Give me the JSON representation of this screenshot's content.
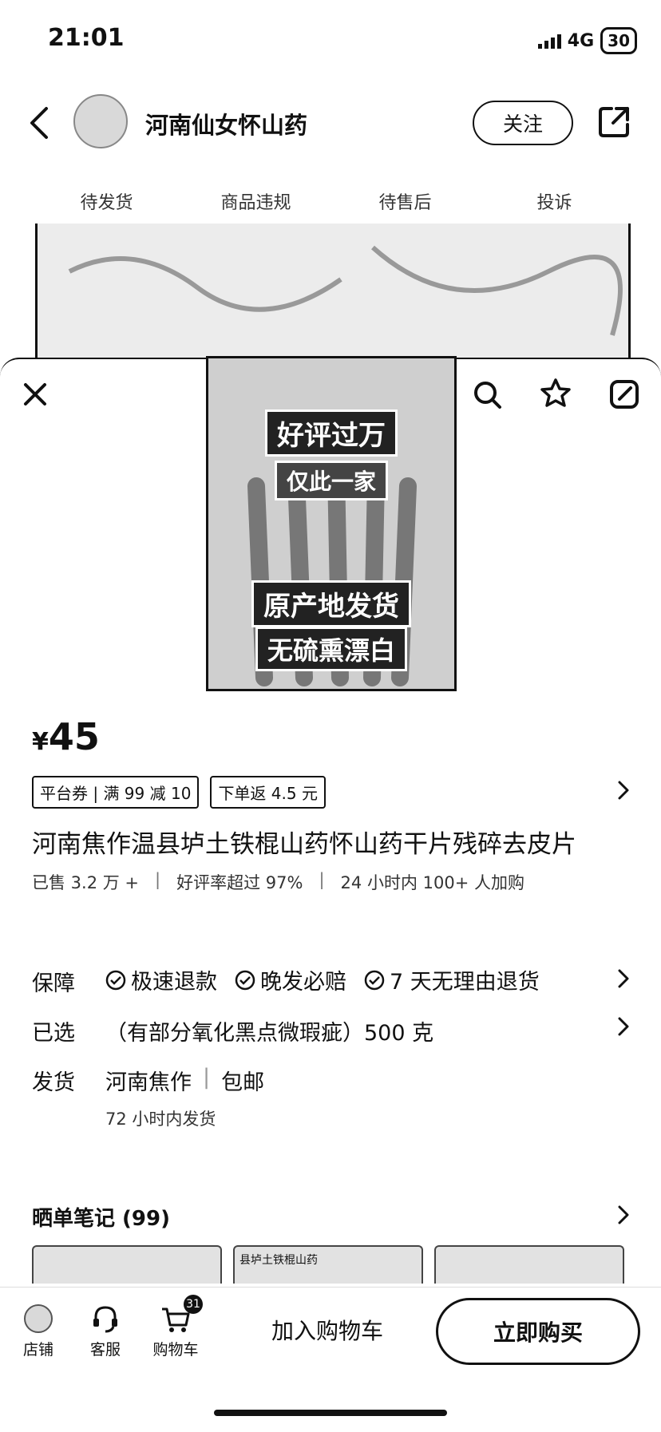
{
  "status": {
    "time": "21:01",
    "network": "4G",
    "battery": "30"
  },
  "header": {
    "shop_name": "河南仙女怀山药",
    "follow_label": "关注"
  },
  "stats": [
    {
      "label": "待发货"
    },
    {
      "label": "商品违规"
    },
    {
      "label": "待售后"
    },
    {
      "label": "投诉"
    }
  ],
  "product_image": {
    "tag1": "好评过万",
    "tag2": "仅此一家",
    "tag3": "原产地发货",
    "tag4": "无硫熏漂白"
  },
  "price": {
    "currency": "¥",
    "value": "45"
  },
  "coupons": [
    "平台券 | 满 99 减 10",
    "下单返 4.5 元"
  ],
  "title": "河南焦作温县垆土铁棍山药怀山药干片残碎去皮片",
  "sales": {
    "sold": "已售 3.2 万 +",
    "rating": "好评率超过 97%",
    "recent": "24 小时内 100+ 人加购"
  },
  "guarantee": {
    "label": "保障",
    "items": [
      "极速退款",
      "晚发必赔",
      "7 天无理由退货"
    ]
  },
  "selected": {
    "label": "已选",
    "value": "（有部分氧化黑点微瑕疵）500 克"
  },
  "shipping": {
    "label": "发货",
    "origin": "河南焦作",
    "fee": "包邮",
    "time": "72 小时内发货"
  },
  "notes": {
    "title": "晒单笔记 (99)",
    "thumb2_text": "县垆土铁棍山药"
  },
  "bottom_bar": {
    "shop": "店铺",
    "service": "客服",
    "cart": "购物车",
    "cart_count": "31",
    "add_to_cart": "加入购物车",
    "buy_now": "立即购买"
  }
}
